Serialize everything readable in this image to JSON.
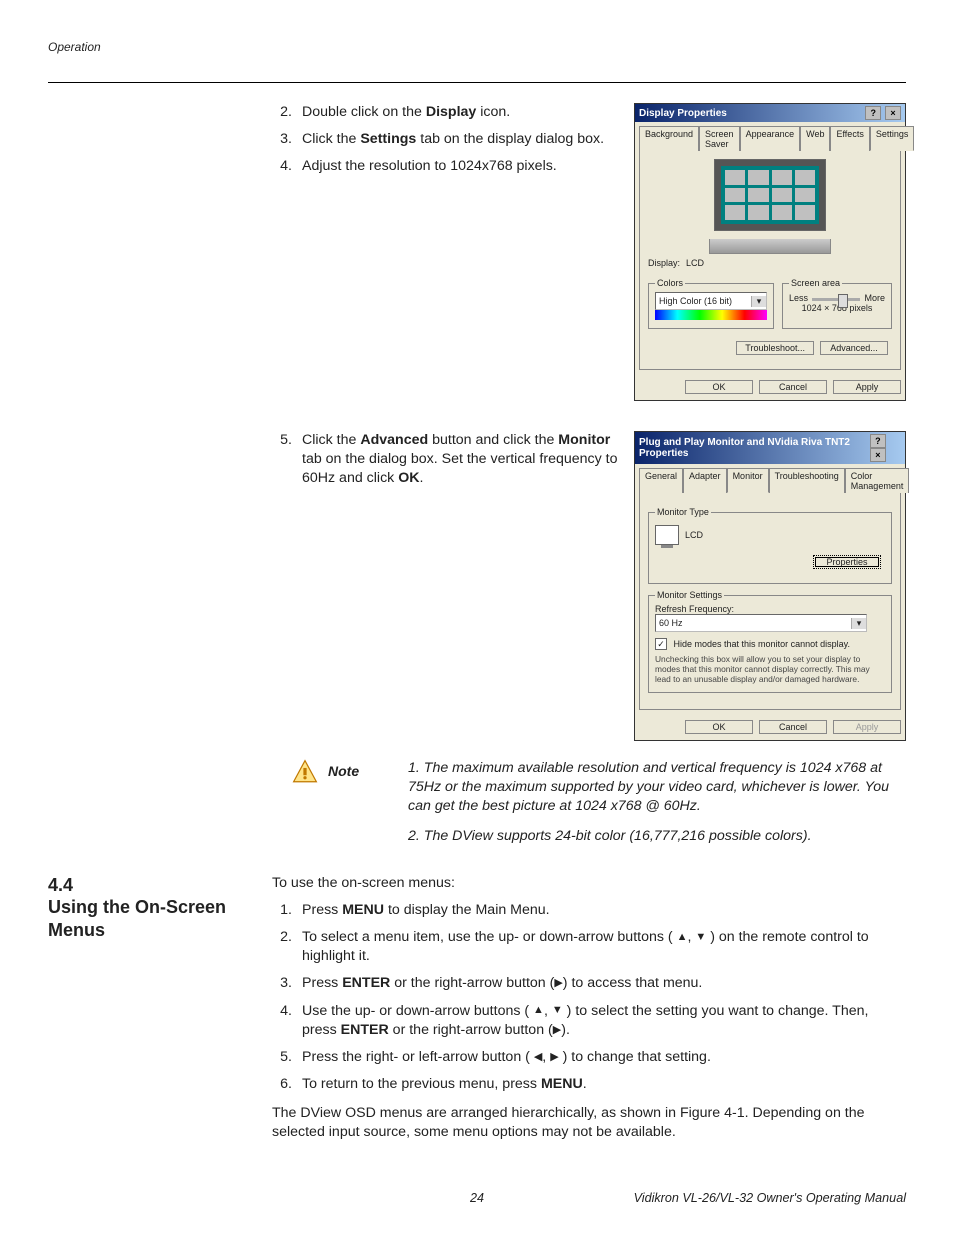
{
  "runningHead": "Operation",
  "stepsTop": [
    {
      "num": "2.",
      "pre": "Double click on the ",
      "bold": "Display",
      "post": " icon."
    },
    {
      "num": "3.",
      "pre": "Click the ",
      "bold": "Settings",
      "post": " tab on the display dialog box."
    },
    {
      "num": "4.",
      "pre": "Adjust the resolution to 1024x768 pixels.",
      "bold": "",
      "post": ""
    }
  ],
  "step5": {
    "num": "5.",
    "t1": "Click the ",
    "b1": "Advanced",
    "t2": " button and click the ",
    "b2": "Monitor",
    "t3": " tab on the dialog box. Set the vertical frequency to 60Hz and click ",
    "b3": "OK",
    "t4": "."
  },
  "dlg1": {
    "title": "Display Properties",
    "tabs": [
      "Background",
      "Screen Saver",
      "Appearance",
      "Web",
      "Effects",
      "Settings"
    ],
    "activeTab": 5,
    "displayLabel": "Display:",
    "displayValue": "LCD",
    "colorsLegend": "Colors",
    "colorsValue": "High Color (16 bit)",
    "screenAreaLegend": "Screen area",
    "less": "Less",
    "more": "More",
    "resText": "1024 × 768 pixels",
    "btnTrouble": "Troubleshoot...",
    "btnAdvanced": "Advanced...",
    "btnOK": "OK",
    "btnCancel": "Cancel",
    "btnApply": "Apply"
  },
  "dlg2": {
    "title": "Plug and Play Monitor and NVidia Riva TNT2 Properties",
    "tabs": [
      "General",
      "Adapter",
      "Monitor",
      "Troubleshooting",
      "Color Management"
    ],
    "activeTab": 2,
    "monTypeLegend": "Monitor Type",
    "monTypeValue": "LCD",
    "btnProperties": "Properties",
    "monSettingsLegend": "Monitor Settings",
    "refreshLabel": "Refresh Frequency:",
    "refreshValue": "60 Hz",
    "hideLabel": "Hide modes that this monitor cannot display.",
    "hideDesc": "Unchecking this box will allow you to set your display to modes that this monitor cannot display correctly. This may lead to an unusable display and/or damaged hardware.",
    "btnOK": "OK",
    "btnCancel": "Cancel",
    "btnApply": "Apply"
  },
  "noteLabel": "Note",
  "note1": "1. The maximum available resolution and vertical frequency is 1024 x768 at 75Hz or the maximum supported by your video card, whichever is lower. You can get the best picture at 1024 x768 @ 60Hz.",
  "note2": "2. The DView supports 24-bit color (16,777,216 possible colors).",
  "section44": {
    "num": "4.4",
    "title": "Using the On-Screen Menus"
  },
  "osdIntro": "To use the on-screen menus:",
  "osdSteps": {
    "s1": {
      "num": "1.",
      "a": "Press ",
      "b1": "MENU",
      "c": " to display the Main Menu."
    },
    "s2pre": "To select a menu item, use the up- or down-arrow buttons ( ",
    "s2post": " ) on the remote control to highlight it.",
    "s3a": "Press ",
    "s3b": "ENTER",
    "s3c": " or the right-arrow button (",
    "s3d": ") to access that menu.",
    "s4a": "Use the up- or down-arrow buttons ( ",
    "s4b": " ) to select the setting you want to change. Then, press ",
    "s4c": "ENTER",
    "s4d": " or the right-arrow button (",
    "s4e": ").",
    "s5a": "Press the right- or left-arrow button ( ",
    "s5b": " ) to change that setting.",
    "s6a": "To return to the previous menu, press ",
    "s6b": "MENU",
    "s6c": "."
  },
  "osdClosing": "The DView OSD menus are arranged hierarchically, as shown in Figure 4-1. Depending on the selected input source, some menu options may not be available.",
  "pageNum": "24",
  "footerRight": "Vidikron VL-26/VL-32 Owner's Operating Manual"
}
